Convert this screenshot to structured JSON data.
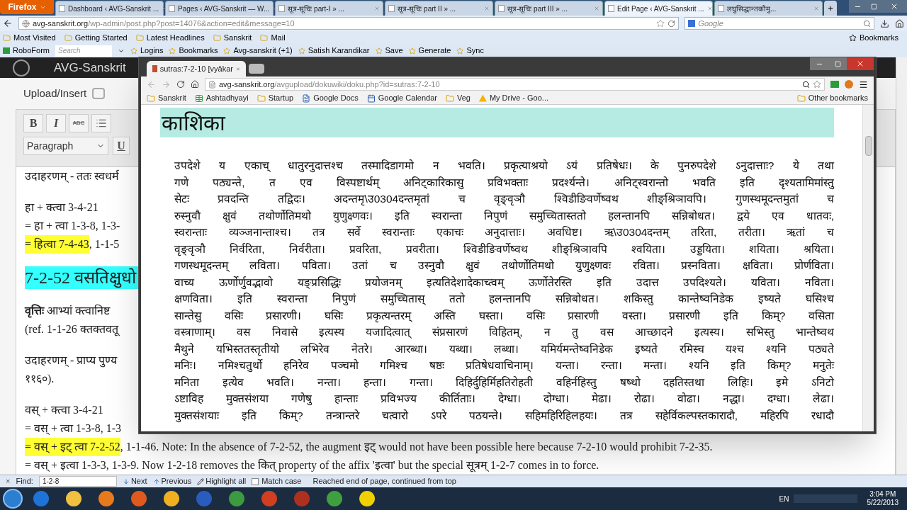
{
  "firefox": {
    "menu_button": "Firefox",
    "tabs": [
      {
        "label": "Dashboard ‹ AVG-Sanskrit ...",
        "selected": false
      },
      {
        "label": "Pages ‹ AVG-Sanskrit — W...",
        "selected": false
      },
      {
        "label": "सूत्र-सूचिः part-I » ...",
        "selected": false
      },
      {
        "label": "सूत्र-सूचिः part II » ...",
        "selected": false
      },
      {
        "label": "सूत्र-सूचिः part III » ...",
        "selected": false
      },
      {
        "label": "Edit Page ‹ AVG-Sanskrit ...",
        "selected": true
      },
      {
        "label": "लघुसिद्धान्तकौमु...",
        "selected": false
      }
    ],
    "new_tab": "+",
    "url": {
      "domain": "avg-sanskrit.org",
      "path": "/wp-admin/post.php?post=14076&action=edit&message=10"
    },
    "search": {
      "placeholder": "Google"
    },
    "bookmarks": [
      "Most Visited",
      "Getting Started",
      "Latest Headlines",
      "Sanskrit",
      "Mail"
    ],
    "bookmarks_menu": "Bookmarks",
    "roboform": {
      "name": "RoboForm",
      "search_placeholder": "Search",
      "items": [
        "Logins",
        "Bookmarks",
        "Avg-sanskrit  (+1)",
        "Satish Karandikar",
        "Save",
        "Generate",
        "Sync"
      ]
    }
  },
  "wp": {
    "site": "AVG-Sanskrit",
    "upload_insert": "Upload/Insert",
    "toolbar": {
      "bold": "B",
      "italic": "I",
      "strike": "ABC",
      "format": "Paragraph",
      "underline": "U"
    },
    "paragraphs": [
      {
        "kind": "text",
        "lines": [
          [
            {
              "text": "उदाहरणम् - ततः स्वधर्म",
              "highlighted": false
            }
          ]
        ]
      },
      {
        "kind": "text",
        "lines": [
          [
            {
              "text": "हा + क्त्वा 3-4-21",
              "highlighted": false
            }
          ],
          [
            {
              "text": "= हा + त्वा 1-3-8, 1-3-",
              "highlighted": false
            }
          ],
          [
            {
              "text": "= हित्वा 7-4-43",
              "highlighted": true
            },
            {
              "text": ", 1-1-5",
              "highlighted": false
            }
          ]
        ]
      },
      {
        "kind": "heading",
        "lines": [
          [
            {
              "text": "7-2-52 वसतिक्षुधो",
              "highlighted": false
            }
          ]
        ]
      },
      {
        "kind": "text",
        "lines": [
          [
            {
              "text": "**वृत्तिः** आभ्यां क्त्वानिष्ट",
              "highlighted": false
            }
          ],
          [
            {
              "text": "(ref. 1-1-26 क्तक्तवतू",
              "highlighted": false
            }
          ]
        ]
      },
      {
        "kind": "text",
        "lines": [
          [
            {
              "text": "उदाहरणम् - प्राप्य पुण्य",
              "highlighted": false
            }
          ],
          [
            {
              "text": "११६०).",
              "highlighted": false
            }
          ]
        ]
      },
      {
        "kind": "text",
        "lines": [
          [
            {
              "text": "वस् + क्त्वा 3-4-21",
              "highlighted": false
            }
          ],
          [
            {
              "text": "= वस् + त्वा 1-3-8, 1-3",
              "highlighted": false
            }
          ],
          [
            {
              "text": "= वस् + इट् त्वा 7-2-52",
              "highlighted": true
            },
            {
              "text": ", 1-1-46. Note: In the absence of 7-2-52, the augment इट् would not have been possible here because 7-2-10 would prohibit 7-2-35.",
              "highlighted": false
            }
          ],
          [
            {
              "text": "= वस् + इत्वा 1-3-3, 1-3-9. Now 1-2-18 removes the कित् property of the affix 'इत्वा' but the special सूत्रम् 1-2-7 comes in to force.",
              "highlighted": false
            }
          ]
        ]
      }
    ]
  },
  "find_bar": {
    "close": "×",
    "label": "Find:",
    "value": "1-2-8",
    "next": "Next",
    "previous": "Previous",
    "highlight_all": "Highlight all",
    "match_case": {
      "label": "Match case",
      "checked": false
    },
    "status": "Reached end of page, continued from top"
  },
  "taskbar": {
    "language": "EN",
    "time": "3:04 PM",
    "date": "5/22/2013"
  },
  "chrome": {
    "tab": "sutras:7-2-10 [vyākar",
    "url": {
      "domain": "avg-sanskrit.org",
      "path": "/avgupload/dokuwiki/doku.php?id=sutras:7-2-10"
    },
    "bookmarks": [
      {
        "kind": "folder",
        "label": "Sanskrit"
      },
      {
        "kind": "sheet",
        "label": "Ashtadhyayi"
      },
      {
        "kind": "folder",
        "label": "Startup"
      },
      {
        "kind": "doc",
        "label": "Google Docs"
      },
      {
        "kind": "calendar",
        "label": "Google Calendar"
      },
      {
        "kind": "folder",
        "label": "Veg"
      },
      {
        "kind": "drive",
        "label": "My Drive - Goo..."
      }
    ],
    "other_bookmarks": "Other bookmarks",
    "heading": "काशिका",
    "lines": [
      "उपदेशे य एकाच् धातुरनुदात्तश्च तस्मादिडागमो न भवति। प्रकृत्याश्रयो ऽयं प्रतिषेधः। के पुनरुपदेशे ऽनुदात्ताः? ये तथा",
      "गणे पठ्यन्ते, त एव विस्पष्टार्थम् अनिट्कारिकासु प्रविभक्ताः प्रदर्श्यन्ते। अनिट्स्वरान्तो भवति इति दृश्यतामिमांस्तु",
      "सेटः प्रवदन्ति तद्विदः। अदन्तमृ\\उ0304दन्तमृतां च वृङ्वृञौ श्विडीङिवर्णेष्वथ शीङ्श्रिञावपि। गुणस्थमूदन्तमुतां च",
      "रुस्नुवौ क्षुवं तथोर्णोतिमथो युणुक्ष्णवः। इति स्वरान्ता निपुणं समुच्चितास्ततो हलन्तानपि सन्निबोधत। द्वये एव धातवः,",
      "स्वरान्ताः व्यञ्जनान्ताश्च। तत्र सर्वे स्वरान्ताः एकाचः अनुदात्ताः। अवधिष्ट। ऋ\\उ0304दन्तम् तरिता, तरीता। ऋतां च",
      "वृङ्वृञौ निर्वरिता, निर्वरीता। प्रवरिता, प्रवरीता। श्विडीङिवर्णेष्वथ शीङ्श्रिञावपि श्वयिता। उड्डयिता। शयिता। श्रयिता।",
      "गणस्थमूदन्तम् लविता। पविता। उतां च उस्नुवौ क्षुवं तथोर्णोतिमथो युणुक्ष्णवः रविता। प्रस्नविता। क्षविता। प्रोर्णविता।",
      "वाच्य ऊर्णोर्णुवद्भावो यङ्प्रसिद्धिः प्रयोजनम् इत्यतिदेशादेकाच्त्वम् ऊर्णोतेरस्ति इति उदात्त उपदिश्यते। यविता। नविता।",
      "क्षणविता। इति स्वरान्ता निपुणं समुच्चितास् ततो हलन्तानपि सन्निबोधत। शकिस्तु कान्तेष्वनिडेक इष्यते घसिश्च",
      "सान्तेसु वसिः प्रसारणी। घसिः प्रकृत्यन्तरम् अस्ति घस्ता। वसिः प्रसारणी वस्ता। प्रसारणी इति किम्? वसिता",
      "वस्त्राणाम्। वस निवासे इत्यस्य यजादित्वात् संप्रसारणं विहितम्, न तु वस आच्छादने इत्यस्य। सभिस्तु भान्तेष्वथ",
      "मैथुने यभिस्ततस्तृतीयो लभिरेव नेतरे। आरब्धा। यब्धा। लब्धा। यमिर्यमन्तेष्वनिडेक इष्यते रमिस्च यश्च श्यनि पठ्यते",
      "मनिः। नमिश्चतुर्थो हनिरेव पञ्चमो गमिश्च षष्ठः प्रतिषेधवाचिनाम्। यन्ता। रन्ता। मन्ता। श्यनि इति किम्? मनुतेः",
      "मनिता इत्येव भवति। नन्ता। हन्ता। गन्ता। दिहिर्दुहिर्मिहतिरोहती वहिर्नहिस्तु षष्थो दहतिस्तथा लिहिः। इमे ऽनिटो",
      "ऽष्टाविह मुक्तसंशया गणेषु हान्ताः प्रविभज्य कीर्तिताः। देग्धा। दोग्धा। मेढा। रोढा। वोढा। नद्धा। दग्धा। लेढा।",
      "मुक्तसंशयाः इति किम्? तन्त्रान्तरे चत्वारो ऽपरे पठयन्ते। सहिमहिरिहिलहयः। तत्र सहेर्विकल्पस्तकारादौ, महिरपि रधादौ"
    ]
  }
}
